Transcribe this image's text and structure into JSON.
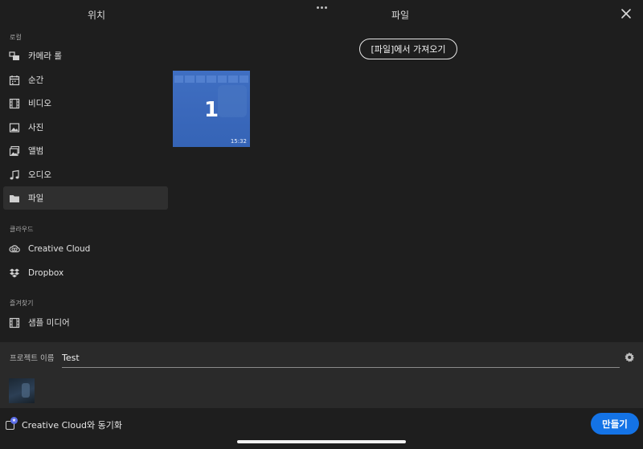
{
  "header": {
    "left_title": "위치",
    "right_title": "파일",
    "more_icon": "more-dots-icon",
    "close_icon": "close-icon"
  },
  "sidebar": {
    "sections": [
      {
        "label": "로컬",
        "items": [
          {
            "label": "카메라 롤",
            "icon": "camera-roll-icon",
            "active": false
          },
          {
            "label": "순간",
            "icon": "calendar-icon",
            "active": false
          },
          {
            "label": "비디오",
            "icon": "film-icon",
            "active": false
          },
          {
            "label": "사진",
            "icon": "photo-icon",
            "active": false
          },
          {
            "label": "앨범",
            "icon": "album-icon",
            "active": false
          },
          {
            "label": "오디오",
            "icon": "music-note-icon",
            "active": false
          },
          {
            "label": "파일",
            "icon": "folder-icon",
            "active": true
          }
        ]
      },
      {
        "label": "클라우드",
        "items": [
          {
            "label": "Creative Cloud",
            "icon": "creative-cloud-icon",
            "active": false
          },
          {
            "label": "Dropbox",
            "icon": "dropbox-icon",
            "active": false
          }
        ]
      },
      {
        "label": "즐겨찾기",
        "items": [
          {
            "label": "샘플 미디어",
            "icon": "film-icon",
            "active": false
          }
        ]
      }
    ]
  },
  "main": {
    "import_button": "[파일]에서 가져오기",
    "file_thumbnail": {
      "count": "1",
      "duration": "15:32"
    }
  },
  "project": {
    "label": "프로젝트 이름",
    "name": "Test",
    "settings_icon": "gear-icon"
  },
  "footer": {
    "sync_label": "Creative Cloud와 동기화",
    "sync_checked": false,
    "create_button": "만들기"
  },
  "colors": {
    "background": "#1e1e1e",
    "panel": "#2a2a2a",
    "accent": "#1473e6",
    "thumbnail": "#3f6fc2"
  }
}
